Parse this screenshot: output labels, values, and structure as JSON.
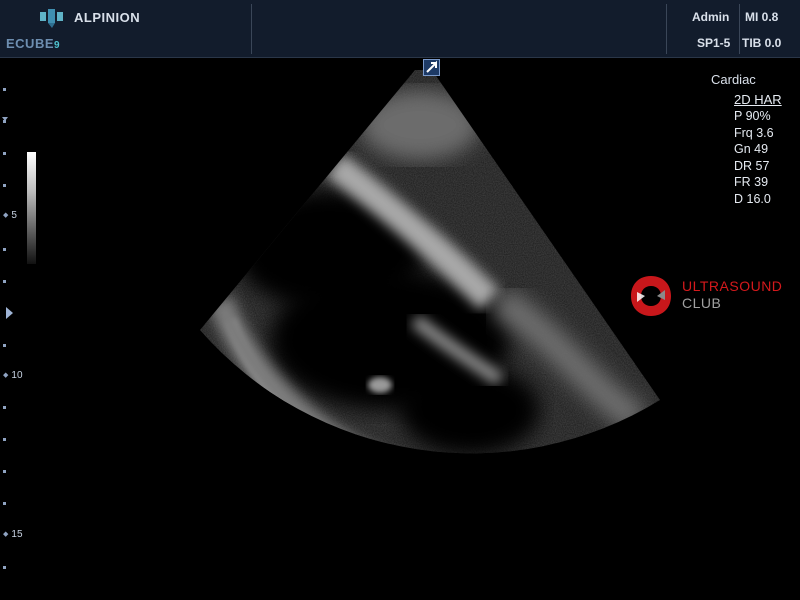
{
  "header": {
    "logo_text": "ECUBE",
    "logo_number": "9",
    "brand": "ALPINION",
    "user": "Admin",
    "mi": "MI 0.8",
    "probe": "SP1-5",
    "tib": "TIB 0.0"
  },
  "depth_scale": {
    "labels": [
      "5",
      "10",
      "15"
    ]
  },
  "parameters": {
    "preset": "Cardiac",
    "mode": "2D HAR",
    "lines": [
      "P 90%",
      "Frq 3.6",
      "Gn 49",
      "DR 57",
      "FR 39",
      "D 16.0"
    ]
  },
  "watermark": {
    "line1": "ULTRASOUND",
    "line2": "CLUB"
  },
  "colors": {
    "header_bg": "#121c2c",
    "watermark_red": "#d4191c",
    "scale_blue": "#8fa3c2"
  }
}
